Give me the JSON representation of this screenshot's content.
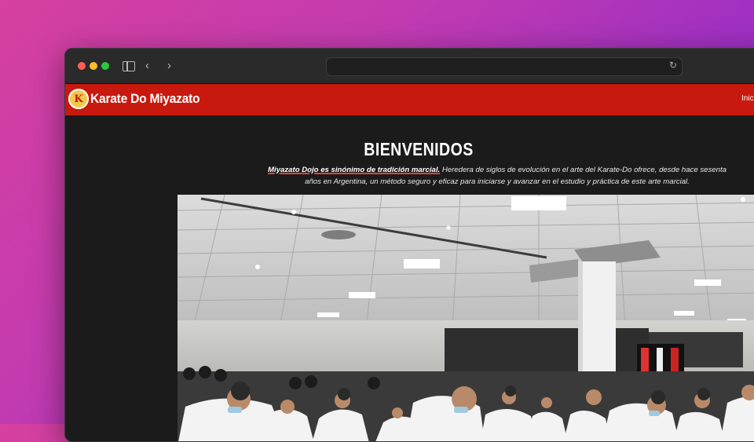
{
  "browser": {
    "url": "",
    "icons": {
      "sidebar": "sidebar-icon",
      "back": "chevron-left-icon",
      "forward": "chevron-right-icon",
      "reload": "reload-icon"
    }
  },
  "site": {
    "logo_letter": "K",
    "title": "Karate Do Miyazato",
    "nav": {
      "first_link": "Inicio"
    },
    "colors": {
      "header": "#c8190f",
      "background": "#1b1b1b",
      "accent": "#f2c94c"
    }
  },
  "main": {
    "heading": "BIENVENIDOS",
    "intro_lead": "Miyazato Dojo es sinónimo de tradición marcial.",
    "intro_rest": " Heredera de siglos de evolución en el arte del Karate-Do ofrece, desde hace sesenta años en Argentina, un método seguro y eficaz para iniciarse y avanzar en el estudio y práctica de este arte marcial."
  }
}
